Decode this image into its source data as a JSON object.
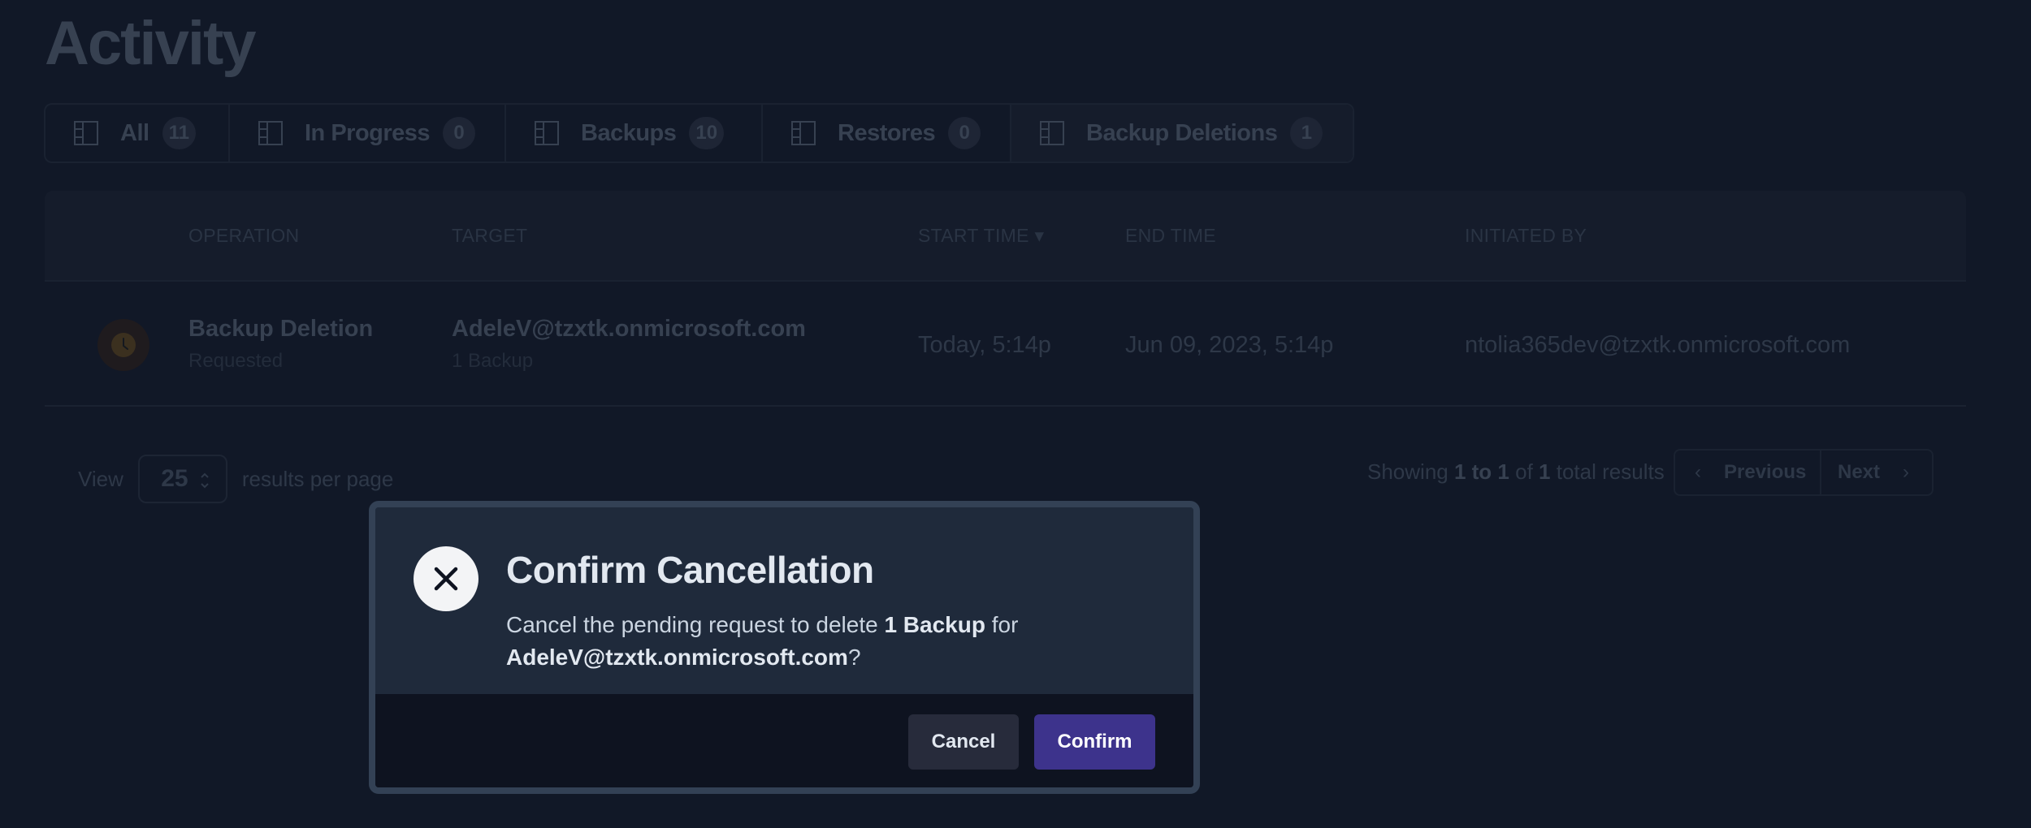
{
  "page": {
    "title": "Activity"
  },
  "tabs": [
    {
      "label": "All",
      "count": "11",
      "icon": "sidebar-layout-icon"
    },
    {
      "label": "In Progress",
      "count": "0",
      "icon": "sidebar-layout-icon"
    },
    {
      "label": "Backups",
      "count": "10",
      "icon": "sidebar-layout-icon"
    },
    {
      "label": "Restores",
      "count": "0",
      "icon": "sidebar-layout-icon"
    },
    {
      "label": "Backup Deletions",
      "count": "1",
      "icon": "sidebar-layout-icon",
      "active": true
    }
  ],
  "table": {
    "headers": {
      "operation": "OPERATION",
      "target": "TARGET",
      "start_time": "START TIME ▾",
      "end_time": "END TIME",
      "initiated_by": "INITIATED BY"
    },
    "rows": [
      {
        "status_icon": "clock-icon",
        "operation": "Backup Deletion",
        "operation_status": "Requested",
        "target": "AdeleV@tzxtk.onmicrosoft.com",
        "target_detail": "1 Backup",
        "start_time": "Today, 5:14p",
        "end_time": "Jun 09, 2023, 5:14p",
        "initiated_by": "ntolia365dev@tzxtk.onmicrosoft.com"
      }
    ]
  },
  "pagination": {
    "view_label": "View",
    "per_page": "25",
    "per_page_suffix": "results per page",
    "showing_prefix": "Showing",
    "range": "1 to 1",
    "of": "of",
    "total": "1",
    "showing_suffix": "total results",
    "previous": "Previous",
    "next": "Next"
  },
  "modal": {
    "title": "Confirm Cancellation",
    "text_prefix": "Cancel the pending request to delete",
    "text_count": "1 Backup",
    "text_for": "for",
    "text_target": "AdeleV@tzxtk.onmicrosoft.com",
    "text_suffix": "?",
    "cancel_label": "Cancel",
    "confirm_label": "Confirm"
  },
  "colors": {
    "background": "#111827",
    "modal_border": "#334155",
    "modal_body": "#1f2a3b",
    "modal_footer": "#0e1320",
    "confirm_button": "#3d338c",
    "cancel_button": "#272b3b",
    "status_pending": "#f59e0b"
  }
}
